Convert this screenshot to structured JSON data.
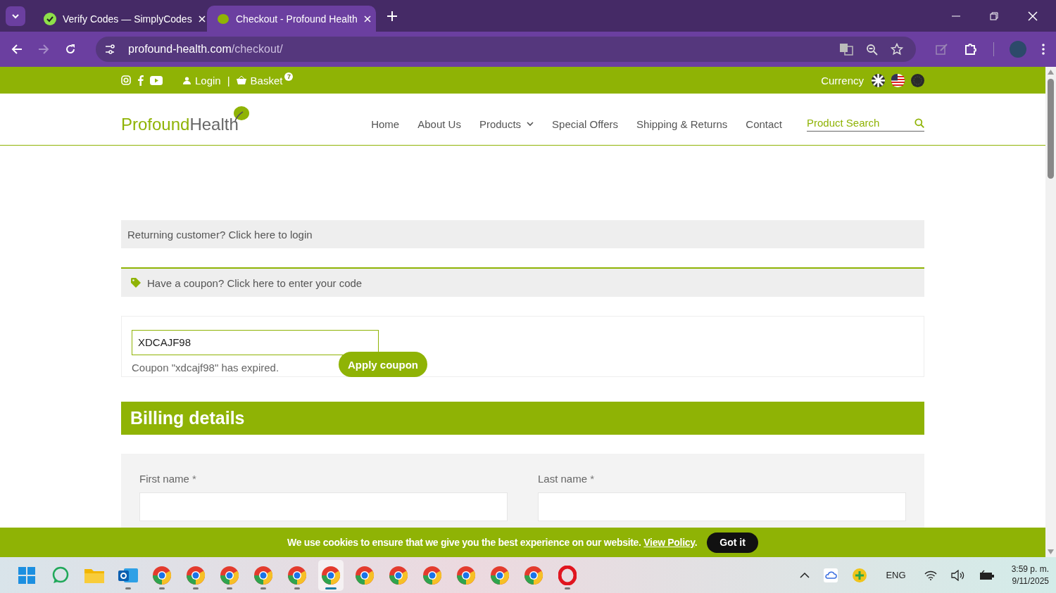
{
  "browser": {
    "tabs": [
      {
        "title": "Verify Codes — SimplyCodes",
        "selected": false,
        "kind": "check"
      },
      {
        "title": "Checkout - Profound Health",
        "selected": true,
        "kind": "leaf"
      }
    ],
    "url": {
      "domain": "profound-health.com",
      "path": "/checkout/"
    }
  },
  "topbar": {
    "login": "Login",
    "separator": "|",
    "basket": "Basket",
    "basket_count": "7",
    "currency": "Currency"
  },
  "logo": {
    "first": "Profound",
    "second": "Health"
  },
  "nav": [
    {
      "label": "Home",
      "kind": "link"
    },
    {
      "label": "About Us",
      "kind": "link"
    },
    {
      "label": "Products",
      "kind": "dropdown"
    },
    {
      "label": "Special Offers",
      "kind": "link"
    },
    {
      "label": "Shipping & Returns",
      "kind": "link"
    },
    {
      "label": "Contact",
      "kind": "link"
    }
  ],
  "search": {
    "placeholder": "Product Search"
  },
  "returning_notice": "Returning customer? Click here to login",
  "coupon_notice": "Have a coupon? Click here to enter your code",
  "coupon_form": {
    "value": "XDCAJF98",
    "error": "Coupon \"xdcajf98\" has expired.",
    "button": "Apply coupon"
  },
  "billing": {
    "title": "Billing details",
    "fields": [
      {
        "label": "First name",
        "mark": "*"
      },
      {
        "label": "Last name",
        "mark": "*"
      }
    ]
  },
  "cookie": {
    "text": "We use cookies to ensure that we give you the best experience on our website.",
    "link": "View Policy",
    "after": ".",
    "button": "Got it"
  },
  "taskbar": {
    "apps": [
      {
        "kind": "start",
        "running": false,
        "selected": false
      },
      {
        "kind": "whatsapp",
        "running": false,
        "selected": false
      },
      {
        "kind": "folder",
        "running": false,
        "selected": false
      },
      {
        "kind": "outlook",
        "running": true,
        "selected": false
      },
      {
        "kind": "chrome",
        "running": true,
        "selected": false
      },
      {
        "kind": "chrome",
        "running": true,
        "selected": false
      },
      {
        "kind": "chrome",
        "running": true,
        "selected": false
      },
      {
        "kind": "chrome",
        "running": true,
        "selected": false
      },
      {
        "kind": "chrome",
        "running": true,
        "selected": false
      },
      {
        "kind": "chrome",
        "running": true,
        "selected": true
      },
      {
        "kind": "chrome",
        "running": false,
        "selected": false
      },
      {
        "kind": "chrome",
        "running": false,
        "selected": false
      },
      {
        "kind": "chrome",
        "running": false,
        "selected": false
      },
      {
        "kind": "chrome",
        "running": false,
        "selected": false
      },
      {
        "kind": "chrome",
        "running": false,
        "selected": false
      },
      {
        "kind": "chrome",
        "running": false,
        "selected": false
      },
      {
        "kind": "opera",
        "running": true,
        "selected": false
      }
    ],
    "language": "ENG",
    "time": "3:59 p. m.",
    "date": "9/11/2025"
  }
}
